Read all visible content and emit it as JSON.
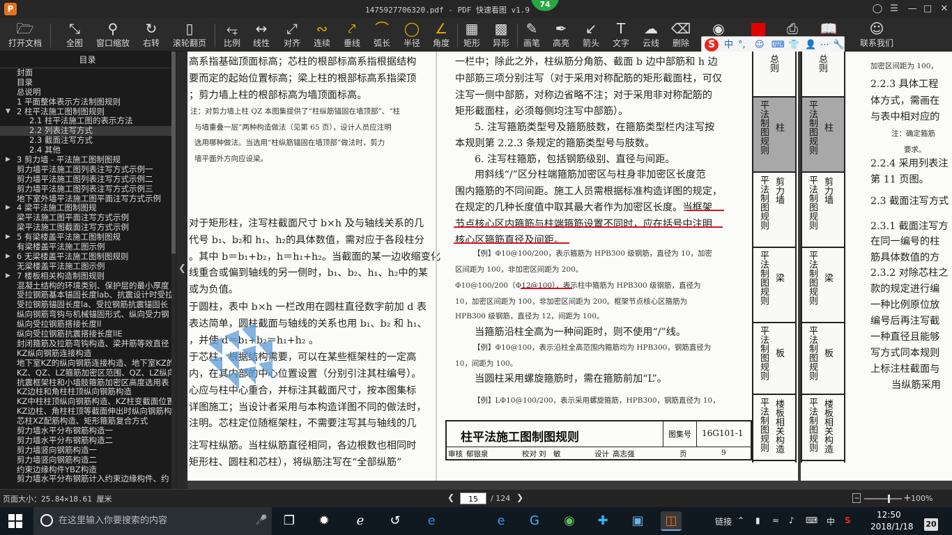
{
  "window": {
    "title": "1475927706320.pdf - PDF 快速看图 v1.9",
    "badge": "74",
    "logo_letter": "P"
  },
  "toolbar": {
    "items": [
      "打开文档",
      "全图",
      "窗口缩放",
      "右转",
      "滚轮翻页",
      "比例",
      "线性",
      "对齐",
      "连续",
      "垂线",
      "弧长",
      "半径",
      "角度",
      "矩形",
      "异形",
      "画笔",
      "高亮",
      "箭头",
      "文字",
      "云线",
      "删除"
    ],
    "right_items": [
      "联系我们"
    ]
  },
  "ime": {
    "logo": "S",
    "items": [
      "中",
      "°,",
      "☺",
      "⌨",
      "👕",
      "👤",
      "⋯",
      "🔧"
    ]
  },
  "sidebar": {
    "header": "目录",
    "items": [
      {
        "text": "封面",
        "indent": 0,
        "arrow": ""
      },
      {
        "text": "目录",
        "indent": 0,
        "arrow": ""
      },
      {
        "text": "总说明",
        "indent": 0,
        "arrow": ""
      },
      {
        "text": "1 平面整体表示方法制图规则",
        "indent": 0,
        "arrow": ""
      },
      {
        "text": "2 柱平法施工图制图规则",
        "indent": 0,
        "arrow": "▼"
      },
      {
        "text": "2.1 柱平法施工图的表示方法",
        "indent": 1,
        "arrow": ""
      },
      {
        "text": "2.2 列表注写方式",
        "indent": 1,
        "arrow": "",
        "selected": true
      },
      {
        "text": "2.3 截面注写方式",
        "indent": 1,
        "arrow": ""
      },
      {
        "text": "2.4 其他",
        "indent": 1,
        "arrow": ""
      },
      {
        "text": "3 剪力墙 - 平法施工图制图规",
        "indent": 0,
        "arrow": "▶"
      },
      {
        "text": "剪力墙平法施工图列表注写方式示例一",
        "indent": 0,
        "arrow": ""
      },
      {
        "text": "剪力墙平法施工图列表注写方式示例二",
        "indent": 0,
        "arrow": ""
      },
      {
        "text": "剪力墙平法施工图列表注写方式示例三",
        "indent": 0,
        "arrow": ""
      },
      {
        "text": "地下室外墙平法施工图平面注写方式示例",
        "indent": 0,
        "arrow": ""
      },
      {
        "text": "4 梁平法施工图制图规",
        "indent": 0,
        "arrow": "▶"
      },
      {
        "text": "梁平法施工图平面注写方式示例",
        "indent": 0,
        "arrow": ""
      },
      {
        "text": "梁平法施工图截面注写方式示例",
        "indent": 0,
        "arrow": ""
      },
      {
        "text": "5 有梁楼盖平法施工图制图规",
        "indent": 0,
        "arrow": "▶"
      },
      {
        "text": "有梁楼盖平法施工图示例",
        "indent": 0,
        "arrow": ""
      },
      {
        "text": "6 无梁楼盖平法施工图制图规则",
        "indent": 0,
        "arrow": "▶"
      },
      {
        "text": "无梁楼盖平法施工图示例",
        "indent": 0,
        "arrow": ""
      },
      {
        "text": "7 楼板相关构造制图规则",
        "indent": 0,
        "arrow": "▶"
      },
      {
        "text": "混凝土结构的环境类别、保护层的最小厚度",
        "indent": 0,
        "arrow": ""
      },
      {
        "text": "受拉钢筋基本锚固长度lab、抗震设计时受拉",
        "indent": 0,
        "arrow": ""
      },
      {
        "text": "受拉钢筋锚固长度la、受拉钢筋抗震锚固长",
        "indent": 0,
        "arrow": ""
      },
      {
        "text": "纵向钢筋弯钩与机械锚固形式、纵向受力钢",
        "indent": 0,
        "arrow": ""
      },
      {
        "text": "纵向受拉钢筋搭接长度ll",
        "indent": 0,
        "arrow": ""
      },
      {
        "text": "纵向受拉钢筋抗震搭接长度llE",
        "indent": 0,
        "arrow": ""
      },
      {
        "text": "封闭箍筋及拉筋弯钩构造、梁并筋等效直径",
        "indent": 0,
        "arrow": ""
      },
      {
        "text": "KZ纵向钢筋连接构造",
        "indent": 0,
        "arrow": ""
      },
      {
        "text": "地下室KZ的纵向钢筋连接构造、地下室KZ的",
        "indent": 0,
        "arrow": ""
      },
      {
        "text": "KZ、QZ、LZ箍筋加密区范围、QZ、LZ纵向钢",
        "indent": 0,
        "arrow": ""
      },
      {
        "text": "抗震框架柱和小墙肢箍筋加密区高度选用表",
        "indent": 0,
        "arrow": ""
      },
      {
        "text": "KZ边柱和角柱柱顶纵向钢筋构造",
        "indent": 0,
        "arrow": ""
      },
      {
        "text": "KZ中柱柱顶纵向钢筋构造、KZ柱变截面位置",
        "indent": 0,
        "arrow": ""
      },
      {
        "text": "KZ边柱、角柱柱顶等截面伸出时纵向钢筋构",
        "indent": 0,
        "arrow": ""
      },
      {
        "text": "芯柱XZ配筋构造、矩形箍筋复合方式",
        "indent": 0,
        "arrow": ""
      },
      {
        "text": "剪力墙水平分布钢筋构造一",
        "indent": 0,
        "arrow": ""
      },
      {
        "text": "剪力墙水平分布钢筋构造二",
        "indent": 0,
        "arrow": ""
      },
      {
        "text": "剪力墙竖向钢筋构造一",
        "indent": 0,
        "arrow": ""
      },
      {
        "text": "剪力墙竖向钢筋构造二",
        "indent": 0,
        "arrow": ""
      },
      {
        "text": "约束边缘构件YBZ构造",
        "indent": 0,
        "arrow": ""
      },
      {
        "text": "剪力墙水平分布钢筋计入约束边缘构件、约",
        "indent": 0,
        "arrow": ""
      }
    ]
  },
  "page": {
    "left_col": [
      "高系指基础顶面标高；芯柱的根部标高系指根据结构",
      "要而定的起始位置标高；梁上柱的根部标高系指梁顶",
      "；剪力墙上柱的根部标高为墙顶面标高。",
      "对于矩形柱，注写柱截面尺寸 b×h 及与轴线关系的几",
      "代号 b₁、b₂和 h₁、h₂的具体数值，需对应于各段柱分",
      "。其中 b＝b₁+b₂，h＝h₁+h₂。当截面的某一边收缩变化",
      "线重合或偏到轴线的另一侧时，b₁、b₂、h₁、h₂中的某",
      "或为负值。",
      "于圆柱，表中 b×h 一栏改用在圆柱直径数字前加 d 表",
      "表达简单，圆柱截面与轴线的关系也用 b₁、b₂ 和 h₁、",
      "，并使 d＝b₁+b₂＝h₁+h₂ 。",
      "于芯柱，根据结构需要，可以在某些框架柱的一定高",
      "内，在其内部的中心位置设置（分别引注其柱编号）。",
      "心应与柱中心重合，并标注其截面尺寸，按本图集标",
      "详图施工；当设计者采用与本构造详图不同的做法时，",
      "注明。芯柱定位随框架柱，不需要注写其与轴线的几",
      "注写柱纵筋。当柱纵筋直径相同，各边根数也相同时",
      "矩形柱、圆柱和芯柱），将纵筋注写在“全部纵筋”"
    ],
    "left_notes": [
      "注：对剪力墙上柱 QZ 本图集提供了“柱纵筋锚固在墙顶部”、“柱",
      "与墙重叠一层”两种构造做法（见第 65 页），设计人员应注明",
      "选用哪种做法。当选用“柱纵筋锚固在墙顶部”做法时，剪力",
      "墙平面外方向应设梁。"
    ],
    "right_col": [
      "一栏中；除此之外，柱纵筋分角筋、截面 b 边中部筋和 h 边",
      "中部筋三项分别注写（对于采用对称配筋的矩形截面柱，可仅",
      "注写一侧中部筋，对称边省略不注；对于采用非对称配筋的",
      "矩形截面柱，必须每侧均注写中部筋）。",
      "5. 注写箍筋类型号及箍筋肢数，在箍筋类型栏内注写按",
      "本规则第 2.2.3 条规定的箍筋类型号与肢数。",
      "6. 注写柱箍筋，包括钢筋级别、直径与间距。",
      "用斜线“/”区分柱端箍筋加密区与柱身非加密区长度范",
      "围内箍筋的不同间距。施工人员需根据标准构造详图的规定，",
      "在规定的几种长度值中取其最大者作为加密区长度。当框架",
      "节点核心区内箍筋与柱端箍筋设置不同时，应在括号中注明",
      "核心区箍筋直径及间距。"
    ],
    "right_notes": [
      "【例】Φ10@100/200，表示箍筋为 HPB300 级钢筋，直径为 10，加密",
      "区间距为 100，非加密区间距为 200。",
      "Φ10@100/200（Φ12@100），表示柱中箍筋为 HPB300 级钢筋，直径为",
      "10，加密区间距为 100，非加密区间距为 200。框架节点核心区箍筋为",
      "HPB300 级钢筋，直径为 12，间距为 100。"
    ],
    "right_tail": [
      "当箍筋沿柱全高为一种间距时，则不使用“/”线。",
      "【例】Φ10@100，表示沿柱全高范围内箍筋均为 HPB300，钢筋直径为",
      "10，间距为 100。",
      "当圆柱采用螺旋箍筋时，需在箍筋前加“L”。",
      "【例】LΦ10@100/200，表示采用螺旋箍筋，HPB300，钢筋直径为 10，"
    ],
    "tabs": [
      {
        "main": "总则",
        "side": ""
      },
      {
        "main": "平法制图规则",
        "side": "柱"
      },
      {
        "main": "平法制图规则",
        "side": "剪力墙"
      },
      {
        "main": "平法制图规则",
        "side": "梁"
      },
      {
        "main": "平法制图规则",
        "side": "板"
      },
      {
        "main": "平法制图规则",
        "side": "楼板相关构造"
      }
    ],
    "title_block": {
      "title": "柱平法施工图制图规则",
      "atlas_label": "图集号",
      "atlas_value": "16G101-1",
      "review_label": "审核",
      "reviewer": "郁银泉",
      "check_label": "校对",
      "checker": "刘　敏",
      "design_label": "设计",
      "designer": "高志强",
      "page_label": "页",
      "page_no": "9"
    }
  },
  "page2": {
    "tabs": [
      {
        "main": "总则",
        "side": ""
      },
      {
        "main": "平法制图规则",
        "side": "柱"
      },
      {
        "main": "平法制图规则",
        "side": "剪力墙"
      },
      {
        "main": "平法制图规则",
        "side": "梁"
      },
      {
        "main": "平法制图规则",
        "side": "板"
      },
      {
        "main": "平法制图规则",
        "side": "楼板相关构造"
      }
    ],
    "lines": [
      {
        "text": "加密区间距为 100，",
        "small": true
      },
      {
        "text": "2.2.3 具体工程",
        "small": false
      },
      {
        "text": "体方式，需画在",
        "small": false
      },
      {
        "text": "与表中相对应的",
        "small": false
      },
      {
        "text": "注：确定箍筋",
        "small": true
      },
      {
        "text": "要求。",
        "small": true
      },
      {
        "text": "2.2.4 采用列表注",
        "small": false
      },
      {
        "text": "第 11 页图。",
        "small": false
      },
      {
        "text": "2.3 截面注写方式",
        "small": false
      },
      {
        "text": "2.3.1 截面注写方",
        "small": false
      },
      {
        "text": "在同一编号的柱",
        "small": false
      },
      {
        "text": "筋具体数值的方",
        "small": false
      },
      {
        "text": "2.3.2 对除芯柱之",
        "small": false
      },
      {
        "text": "款的规定进行编",
        "small": false
      },
      {
        "text": "一种比例原位放",
        "small": false
      },
      {
        "text": "编号后再注写截",
        "small": false
      },
      {
        "text": "一种直径且能够",
        "small": false
      },
      {
        "text": "写方式同本规则",
        "small": false
      },
      {
        "text": "上标注柱截面与",
        "small": false
      },
      {
        "text": "当纵筋采用",
        "small": false
      }
    ]
  },
  "status": {
    "page_size": "页面大小：25.84×18.61 厘米",
    "current_page": "15",
    "total_pages": "/ 124",
    "zoom": "100%"
  },
  "taskbar": {
    "search_placeholder": "在这里输入你要搜索的内容",
    "tray_link": "链接",
    "ime_lang": "中",
    "time": "12:50",
    "date": "2018/1/18",
    "notifications": "20"
  }
}
